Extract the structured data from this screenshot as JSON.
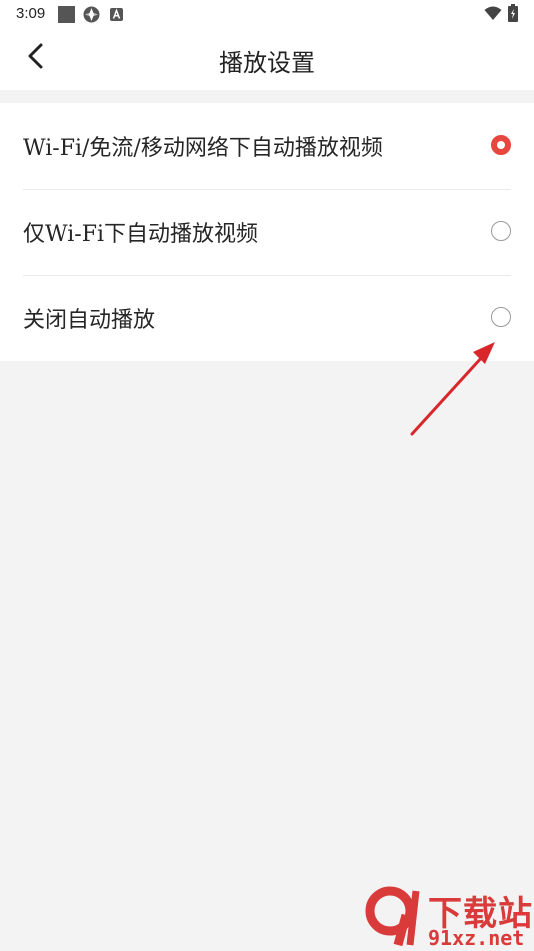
{
  "status_bar": {
    "time": "3:09"
  },
  "header": {
    "title": "播放设置"
  },
  "options": [
    {
      "label": "Wi-Fi/免流/移动网络下自动播放视频",
      "selected": true
    },
    {
      "label": "仅Wi-Fi下自动播放视频",
      "selected": false
    },
    {
      "label": "关闭自动播放",
      "selected": false
    }
  ],
  "colors": {
    "accent": "#e8473f",
    "annotation_arrow": "#d9262b"
  },
  "watermark": {
    "text_top": "下载站",
    "text_bottom": "91xz.net"
  }
}
